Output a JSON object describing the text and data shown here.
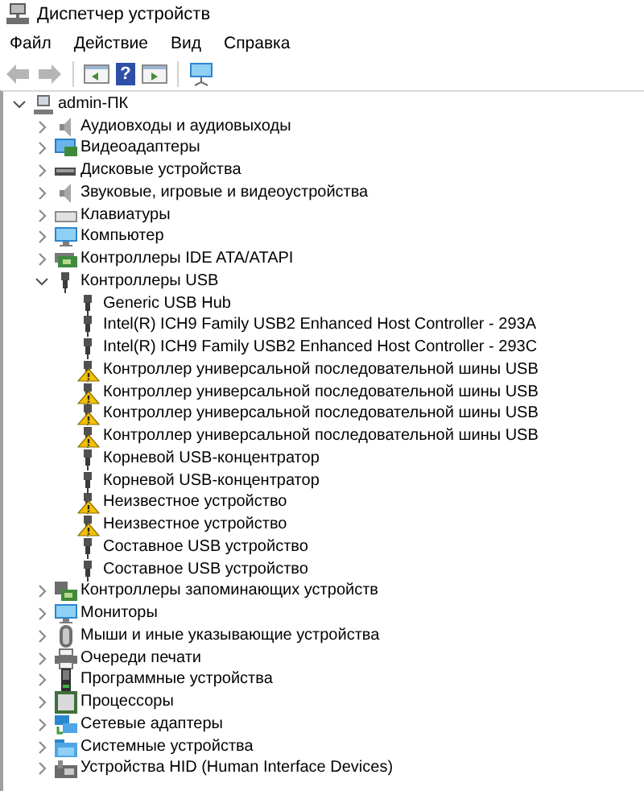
{
  "window": {
    "title": "Диспетчер устройств"
  },
  "menu": [
    "Файл",
    "Действие",
    "Вид",
    "Справка"
  ],
  "toolbar": [
    {
      "kind": "back",
      "disabled": true
    },
    {
      "kind": "forward",
      "disabled": true
    },
    {
      "kind": "separator"
    },
    {
      "kind": "properties"
    },
    {
      "kind": "help",
      "label": "?"
    },
    {
      "kind": "update"
    },
    {
      "kind": "separator"
    },
    {
      "kind": "scan"
    }
  ],
  "tree": {
    "label": "admin-ПК",
    "kind": "computer-root",
    "expanded": true,
    "children": [
      {
        "label": "Аудиовходы и аудиовыходы",
        "kind": "audio",
        "expanded": false
      },
      {
        "label": "Видеоадаптеры",
        "kind": "display",
        "expanded": false
      },
      {
        "label": "Дисковые устройства",
        "kind": "disk",
        "expanded": false
      },
      {
        "label": "Звуковые, игровые и видеоустройства",
        "kind": "audio",
        "expanded": false
      },
      {
        "label": "Клавиатуры",
        "kind": "keyboard",
        "expanded": false
      },
      {
        "label": "Компьютер",
        "kind": "monitor",
        "expanded": false
      },
      {
        "label": "Контроллеры IDE ATA/ATAPI",
        "kind": "board",
        "expanded": false
      },
      {
        "label": "Контроллеры USB",
        "kind": "usb",
        "expanded": true,
        "children": [
          {
            "label": "Generic USB Hub",
            "kind": "usb",
            "warning": false
          },
          {
            "label": "Intel(R) ICH9 Family USB2 Enhanced Host Controller - 293A",
            "kind": "usb",
            "warning": false
          },
          {
            "label": "Intel(R) ICH9 Family USB2 Enhanced Host Controller - 293C",
            "kind": "usb",
            "warning": false
          },
          {
            "label": "Контроллер универсальной последовательной шины USB",
            "kind": "usb",
            "warning": true
          },
          {
            "label": "Контроллер универсальной последовательной шины USB",
            "kind": "usb",
            "warning": true
          },
          {
            "label": "Контроллер универсальной последовательной шины USB",
            "kind": "usb",
            "warning": true
          },
          {
            "label": "Контроллер универсальной последовательной шины USB",
            "kind": "usb",
            "warning": true
          },
          {
            "label": "Корневой USB-концентратор",
            "kind": "usb",
            "warning": false
          },
          {
            "label": "Корневой USB-концентратор",
            "kind": "usb",
            "warning": false
          },
          {
            "label": "Неизвестное устройство",
            "kind": "usb",
            "warning": true
          },
          {
            "label": "Неизвестное устройство",
            "kind": "usb",
            "warning": true
          },
          {
            "label": "Составное USB устройство",
            "kind": "usb",
            "warning": false
          },
          {
            "label": "Составное USB устройство",
            "kind": "usb",
            "warning": false
          }
        ]
      },
      {
        "label": "Контроллеры запоминающих устройств",
        "kind": "storage",
        "expanded": false
      },
      {
        "label": "Мониторы",
        "kind": "monitor",
        "expanded": false
      },
      {
        "label": "Мыши и иные указывающие устройства",
        "kind": "mouse",
        "expanded": false
      },
      {
        "label": "Очереди печати",
        "kind": "printer",
        "expanded": false
      },
      {
        "label": "Программные устройства",
        "kind": "software",
        "expanded": false
      },
      {
        "label": "Процессоры",
        "kind": "cpu",
        "expanded": false
      },
      {
        "label": "Сетевые адаптеры",
        "kind": "network",
        "expanded": false
      },
      {
        "label": "Системные устройства",
        "kind": "system",
        "expanded": false
      },
      {
        "label": "Устройства HID (Human Interface Devices)",
        "kind": "hid",
        "expanded": false
      }
    ]
  }
}
